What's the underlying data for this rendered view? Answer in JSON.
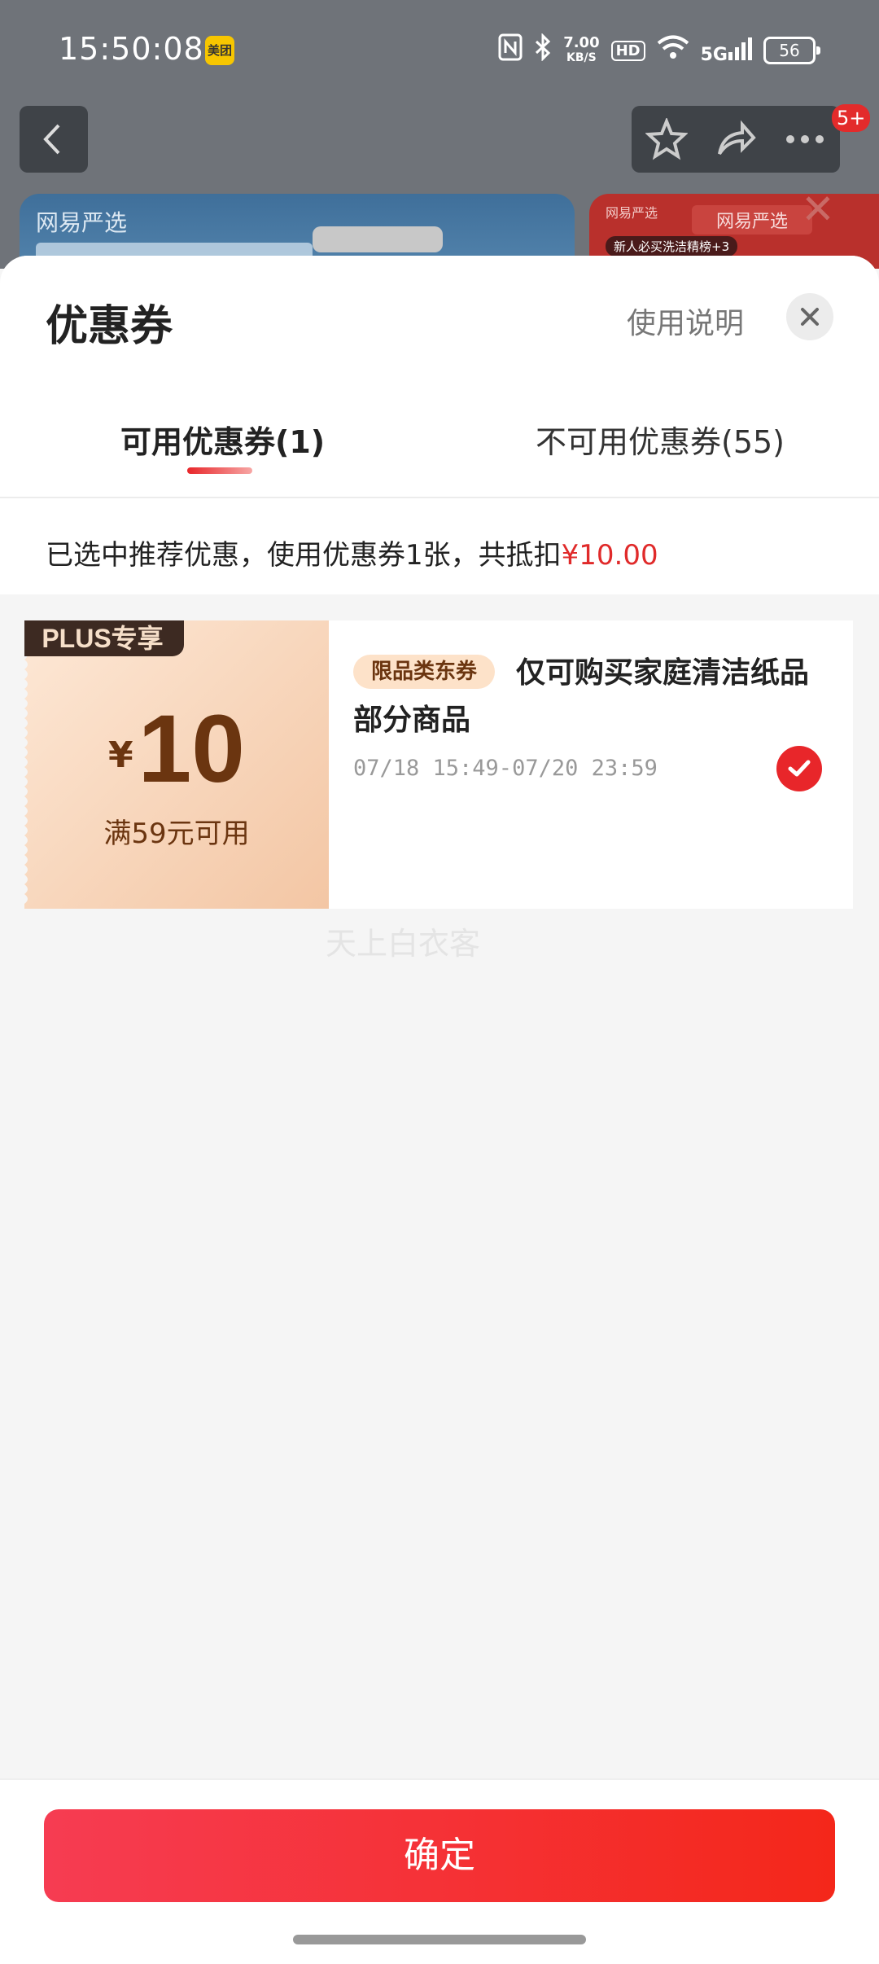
{
  "status_bar": {
    "time": "15:50:08",
    "app_badge": "美团",
    "speed_value": "7.00",
    "speed_unit": "KB/S",
    "hd": "HD",
    "network": "5G",
    "battery": "56"
  },
  "nav": {
    "cart_badge": "5+"
  },
  "background": {
    "banner1_brand": "网易严选",
    "banner2_brand": "网易严选",
    "banner2_brand_main": "网易严选",
    "banner2_pill": "新人必买洗洁精榜+3"
  },
  "sheet": {
    "title": "优惠券",
    "help_link": "使用说明",
    "tabs": [
      {
        "label": "可用优惠券(1)",
        "active": true
      },
      {
        "label": "不可用优惠券(55)",
        "active": false
      }
    ],
    "summary_prefix": "已选中推荐优惠，使用优惠券1张，共抵扣",
    "summary_amount": "¥10.00",
    "coupon": {
      "tag": "PLUS专享",
      "currency": "¥",
      "amount": "10",
      "threshold": "满59元可用",
      "category_tag": "限品类东券",
      "description": "仅可购买家庭清洁纸品部分商品",
      "validity": "07/18 15:49-07/20 23:59",
      "selected": true
    },
    "watermark": "天上白衣客",
    "confirm_label": "确定"
  },
  "colors": {
    "accent": "#e8262a",
    "coupon_text": "#6b3510"
  }
}
